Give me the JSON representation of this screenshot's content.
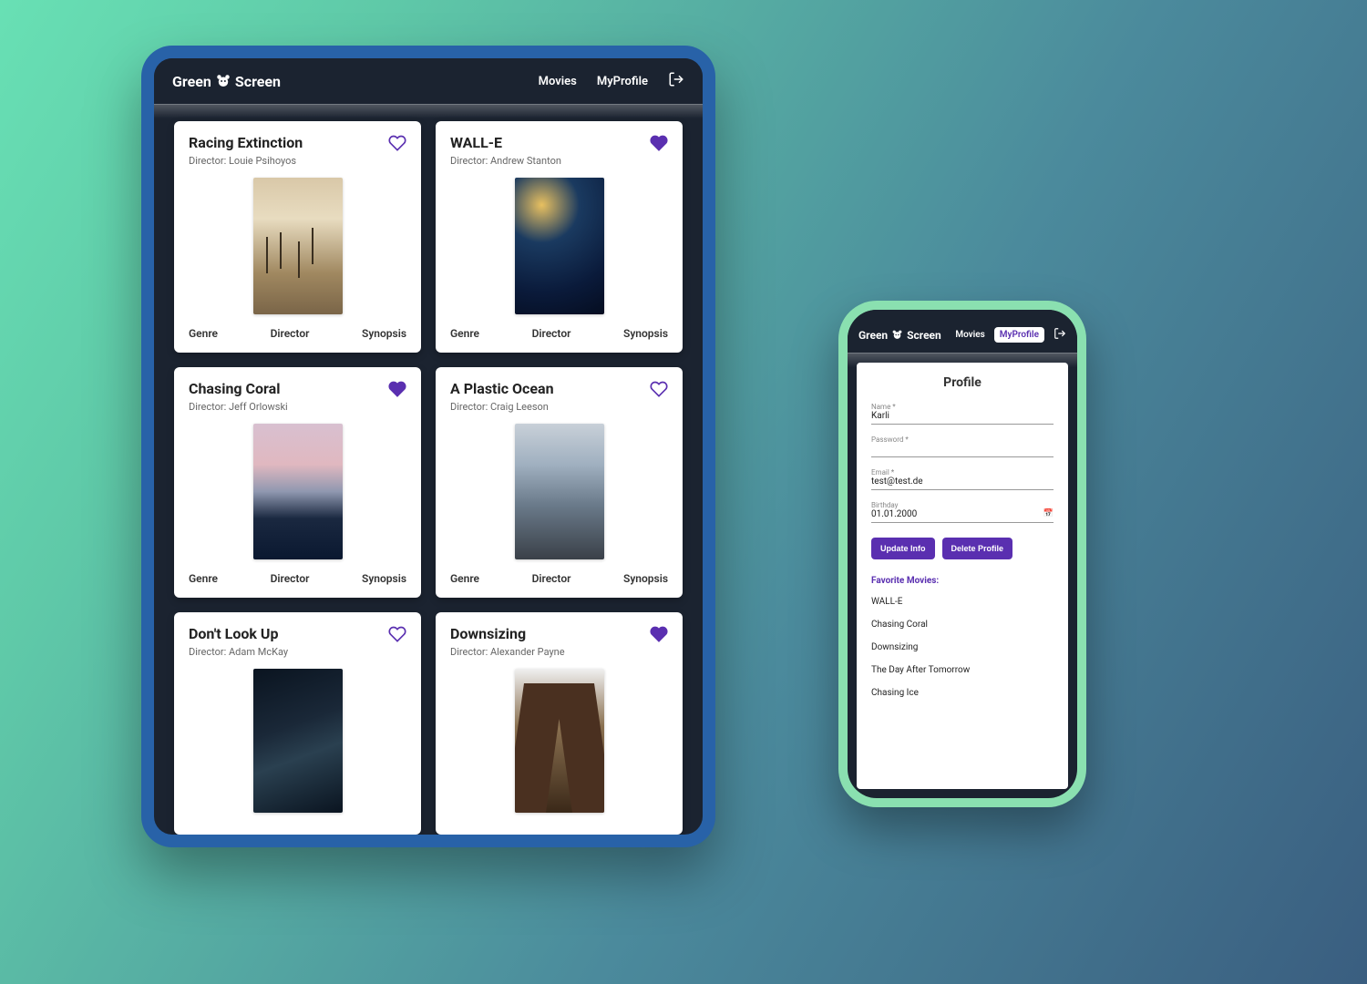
{
  "brand": {
    "part1": "Green",
    "part2": "Screen"
  },
  "nav": {
    "movies": "Movies",
    "profile": "MyProfile"
  },
  "card_labels": {
    "genre": "Genre",
    "director": "Director",
    "synopsis": "Synopsis",
    "director_prefix": "Director: "
  },
  "movies": [
    {
      "title": "Racing Extinction",
      "director": "Louie Psihoyos",
      "favorite": false
    },
    {
      "title": "WALL-E",
      "director": "Andrew Stanton",
      "favorite": true
    },
    {
      "title": "Chasing Coral",
      "director": "Jeff Orlowski",
      "favorite": true
    },
    {
      "title": "A Plastic Ocean",
      "director": "Craig Leeson",
      "favorite": false
    },
    {
      "title": "Don't Look Up",
      "director": "Adam McKay",
      "favorite": false
    },
    {
      "title": "Downsizing",
      "director": "Alexander Payne",
      "favorite": true
    }
  ],
  "profile": {
    "heading": "Profile",
    "fields": {
      "name_label": "Name *",
      "name_value": "Karli",
      "password_label": "Password *",
      "password_value": "",
      "email_label": "Email *",
      "email_value": "test@test.de",
      "birthday_label": "Birthday",
      "birthday_value": "01.01.2000"
    },
    "buttons": {
      "update": "Update Info",
      "delete": "Delete Profile"
    },
    "favorites_heading": "Favorite Movies:",
    "favorites": [
      "WALL-E",
      "Chasing Coral",
      "Downsizing",
      "The Day After Tomorrow",
      "Chasing Ice"
    ]
  },
  "colors": {
    "accent": "#5a2fb0"
  }
}
